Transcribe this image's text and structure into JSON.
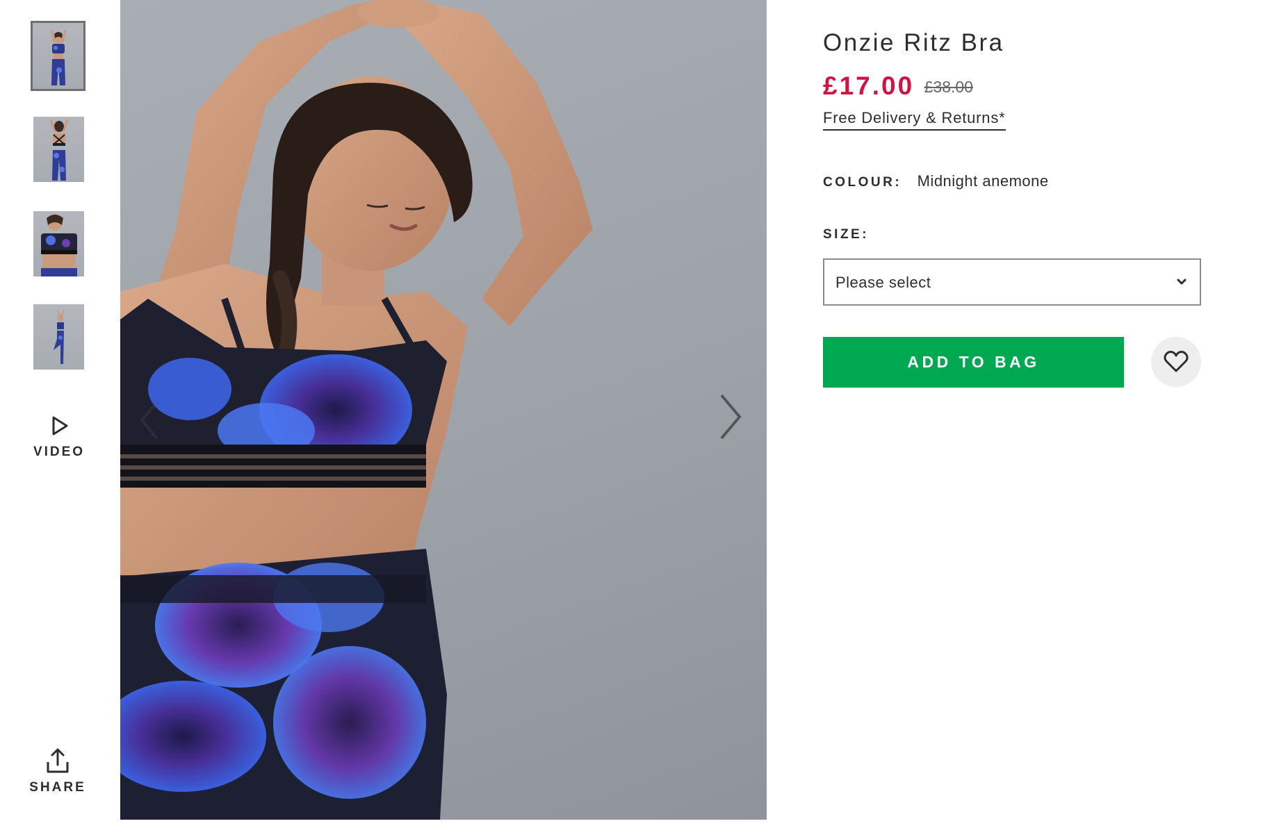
{
  "product": {
    "title": "Onzie Ritz Bra",
    "price_current": "£17.00",
    "price_original": "£38.00",
    "delivery_link": "Free Delivery & Returns*",
    "colour_label": "COLOUR:",
    "colour_value": "Midnight anemone",
    "size_label": "SIZE:",
    "size_placeholder": "Please select",
    "add_to_bag": "ADD TO BAG"
  },
  "gallery": {
    "thumbnails": [
      {
        "view": "front",
        "active": true
      },
      {
        "view": "back",
        "active": false
      },
      {
        "view": "close-up",
        "active": false
      },
      {
        "view": "full-length",
        "active": false
      }
    ],
    "video_label": "VIDEO",
    "share_label": "SHARE"
  },
  "icons": {
    "video": "play-icon",
    "share": "share-icon",
    "next": "chevron-right-icon",
    "previous": "chevron-left-icon",
    "select": "chevron-down-icon",
    "save": "heart-icon"
  },
  "colors": {
    "price_sale": "#d01345",
    "add_to_bag_bg": "#00a852",
    "text": "#2d2d2d",
    "save_button_bg": "#eeeeee"
  }
}
